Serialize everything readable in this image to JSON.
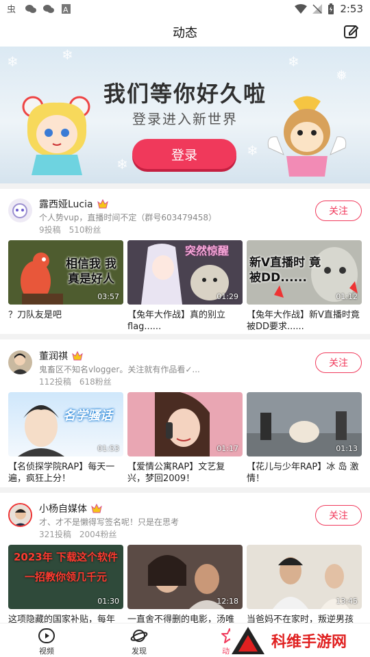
{
  "status_bar": {
    "time": "2:53"
  },
  "header": {
    "title": "动态"
  },
  "banner": {
    "title": "我们等你好久啦",
    "subtitle": "登录进入新世界",
    "login_label": "登录"
  },
  "cards": [
    {
      "name": "露西娅Lucia",
      "desc": "个人势vup，直播时间不定（群号603479458）",
      "stats": "9投稿　510粉丝",
      "follow_label": "关注",
      "videos": [
        {
          "duration": "03:57",
          "title": "？刀队友是吧",
          "thumb_text": "相信我 我真是好人"
        },
        {
          "duration": "01:29",
          "title": "【兔年大作战】真的别立flag......",
          "thumb_text": "突然惊醒"
        },
        {
          "duration": "01:12",
          "title": "【兔年大作战】新V直播时竟被DD要求......",
          "thumb_text": "新V直播时 竟被DD......"
        }
      ]
    },
    {
      "name": "董润祺",
      "desc": "鬼畜区不知名vlogger。关注就有作品看✓...",
      "stats": "112投稿　618粉丝",
      "follow_label": "关注",
      "videos": [
        {
          "duration": "01:53",
          "title": "【名侦探学院RAP】每天一遍，疯狂上分！",
          "thumb_text": "名学骚话"
        },
        {
          "duration": "01:17",
          "title": "【爱情公寓RAP】文艺复兴，梦回2009！",
          "thumb_text": ""
        },
        {
          "duration": "01:13",
          "title": "【花儿与少年RAP】冰 岛 激 情！",
          "thumb_text": ""
        }
      ]
    },
    {
      "name": "小杨自媒体",
      "desc": "才、才不是懒得写签名呢！只是在思考",
      "stats": "321投稿　2004粉丝",
      "follow_label": "关注",
      "videos": [
        {
          "duration": "01:30",
          "title": "这项隐藏的国家补贴，每年",
          "thumb_text": "2023年 下载这个软件 一招教你领几千元"
        },
        {
          "duration": "12:18",
          "title": "一直舍不得删的电影，汤唯",
          "thumb_text": ""
        },
        {
          "duration": "13:45",
          "title": "当爸妈不在家时，叛逆男孩",
          "thumb_text": ""
        }
      ]
    }
  ],
  "bottom_nav": [
    {
      "label": "视频",
      "icon": "play-icon"
    },
    {
      "label": "发现",
      "icon": "planet-icon"
    },
    {
      "label": "动态",
      "icon": "star-icon"
    }
  ],
  "watermark": {
    "text": "科维手游网"
  },
  "colors": {
    "accent": "#f0395b",
    "gold": "#f5c518"
  }
}
